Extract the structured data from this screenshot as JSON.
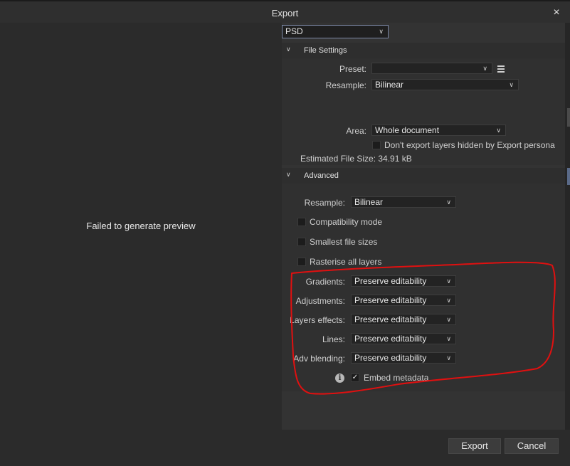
{
  "window": {
    "title": "Export",
    "close_icon": "×"
  },
  "preview": {
    "message": "Failed to generate preview"
  },
  "format": {
    "value": "PSD"
  },
  "file_settings": {
    "header": "File Settings",
    "preset_label": "Preset:",
    "preset_value": "",
    "resample_label": "Resample:",
    "resample_value": "Bilinear",
    "area_label": "Area:",
    "area_value": "Whole document",
    "dont_export_hidden_label": "Don't export layers hidden by Export persona",
    "dont_export_hidden_checked": false,
    "estimated_size": "Estimated File Size: 34.91 kB"
  },
  "advanced": {
    "header": "Advanced",
    "resample_label": "Resample:",
    "resample_value": "Bilinear",
    "compatibility_label": "Compatibility mode",
    "smallest_label": "Smallest file sizes",
    "rasterise_label": "Rasterise all layers",
    "gradients_label": "Gradients:",
    "gradients_value": "Preserve editability",
    "adjustments_label": "Adjustments:",
    "adjustments_value": "Preserve editability",
    "layer_effects_label": "Layers effects:",
    "layer_effects_value": "Preserve editability",
    "lines_label": "Lines:",
    "lines_value": "Preserve editability",
    "adv_blending_label": "Adv blending:",
    "adv_blending_value": "Preserve editability",
    "embed_metadata_label": "Embed metadata",
    "embed_metadata_checked": true,
    "info_icon": "i"
  },
  "buttons": {
    "export": "Export",
    "cancel": "Cancel"
  },
  "colors": {
    "annotation": "#e01010",
    "background": "#2b2b2b",
    "panel": "#303030"
  }
}
